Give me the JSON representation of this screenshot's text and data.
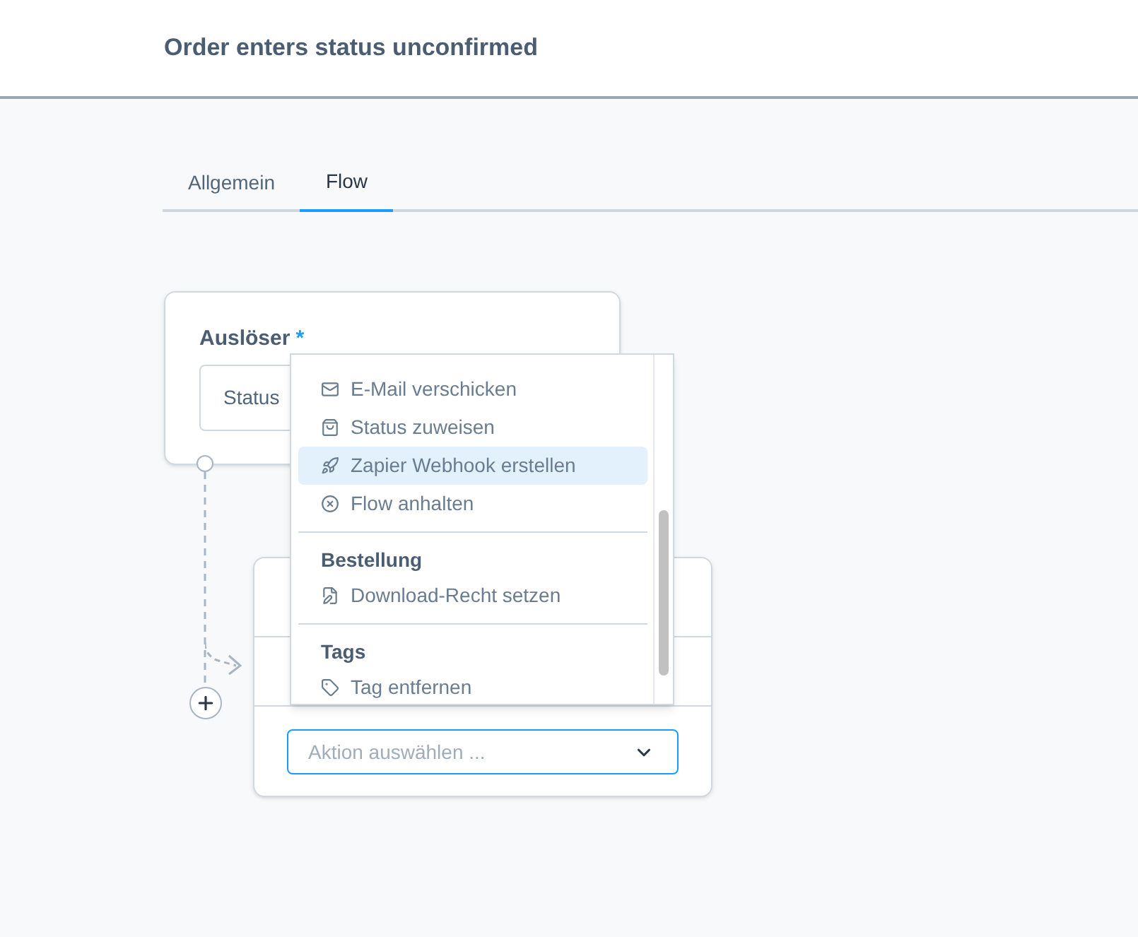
{
  "header": {
    "title": "Order enters status unconfirmed"
  },
  "tabs": [
    {
      "label": "Allgemein",
      "selected": false
    },
    {
      "label": "Flow",
      "selected": true
    }
  ],
  "trigger": {
    "label": "Auslöser",
    "required_mark": "*",
    "value": "Status"
  },
  "action": {
    "select": {
      "placeholder": "Aktion auswählen ..."
    }
  },
  "dropdown": {
    "groups": [
      {
        "items": [
          {
            "kind": "mail",
            "label": "E-Mail verschicken",
            "selected": false
          },
          {
            "kind": "status",
            "label": "Status zuweisen",
            "selected": false
          },
          {
            "kind": "rocket",
            "label": "Zapier Webhook erstellen",
            "selected": true
          },
          {
            "kind": "stop",
            "label": "Flow anhalten",
            "selected": false
          }
        ]
      },
      {
        "heading": "Bestellung",
        "items": [
          {
            "kind": "edit",
            "label": "Download-Recht setzen",
            "selected": false
          }
        ]
      },
      {
        "heading": "Tags",
        "items": [
          {
            "kind": "tag",
            "label": "Tag entfernen",
            "selected": false
          }
        ]
      }
    ]
  }
}
